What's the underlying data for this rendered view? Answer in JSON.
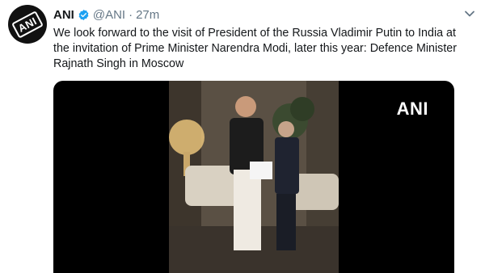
{
  "tweet": {
    "author_name": "ANI",
    "handle": "@ANI",
    "separator": "·",
    "time": "27m",
    "text": "We look forward to the visit of President of the Russia Vladimir Putin to India at the invitation of Prime Minister Narendra Modi, later this year: Defence Minister Rajnath Singh in Moscow",
    "avatar_logo": "ANI",
    "media_watermark": "ANI"
  },
  "icons": {
    "verified": "verified-badge-icon",
    "more": "chevron-down-icon"
  },
  "colors": {
    "text": "#14171a",
    "secondary": "#657786",
    "verified": "#1da1f2",
    "media_bg": "#000000"
  }
}
